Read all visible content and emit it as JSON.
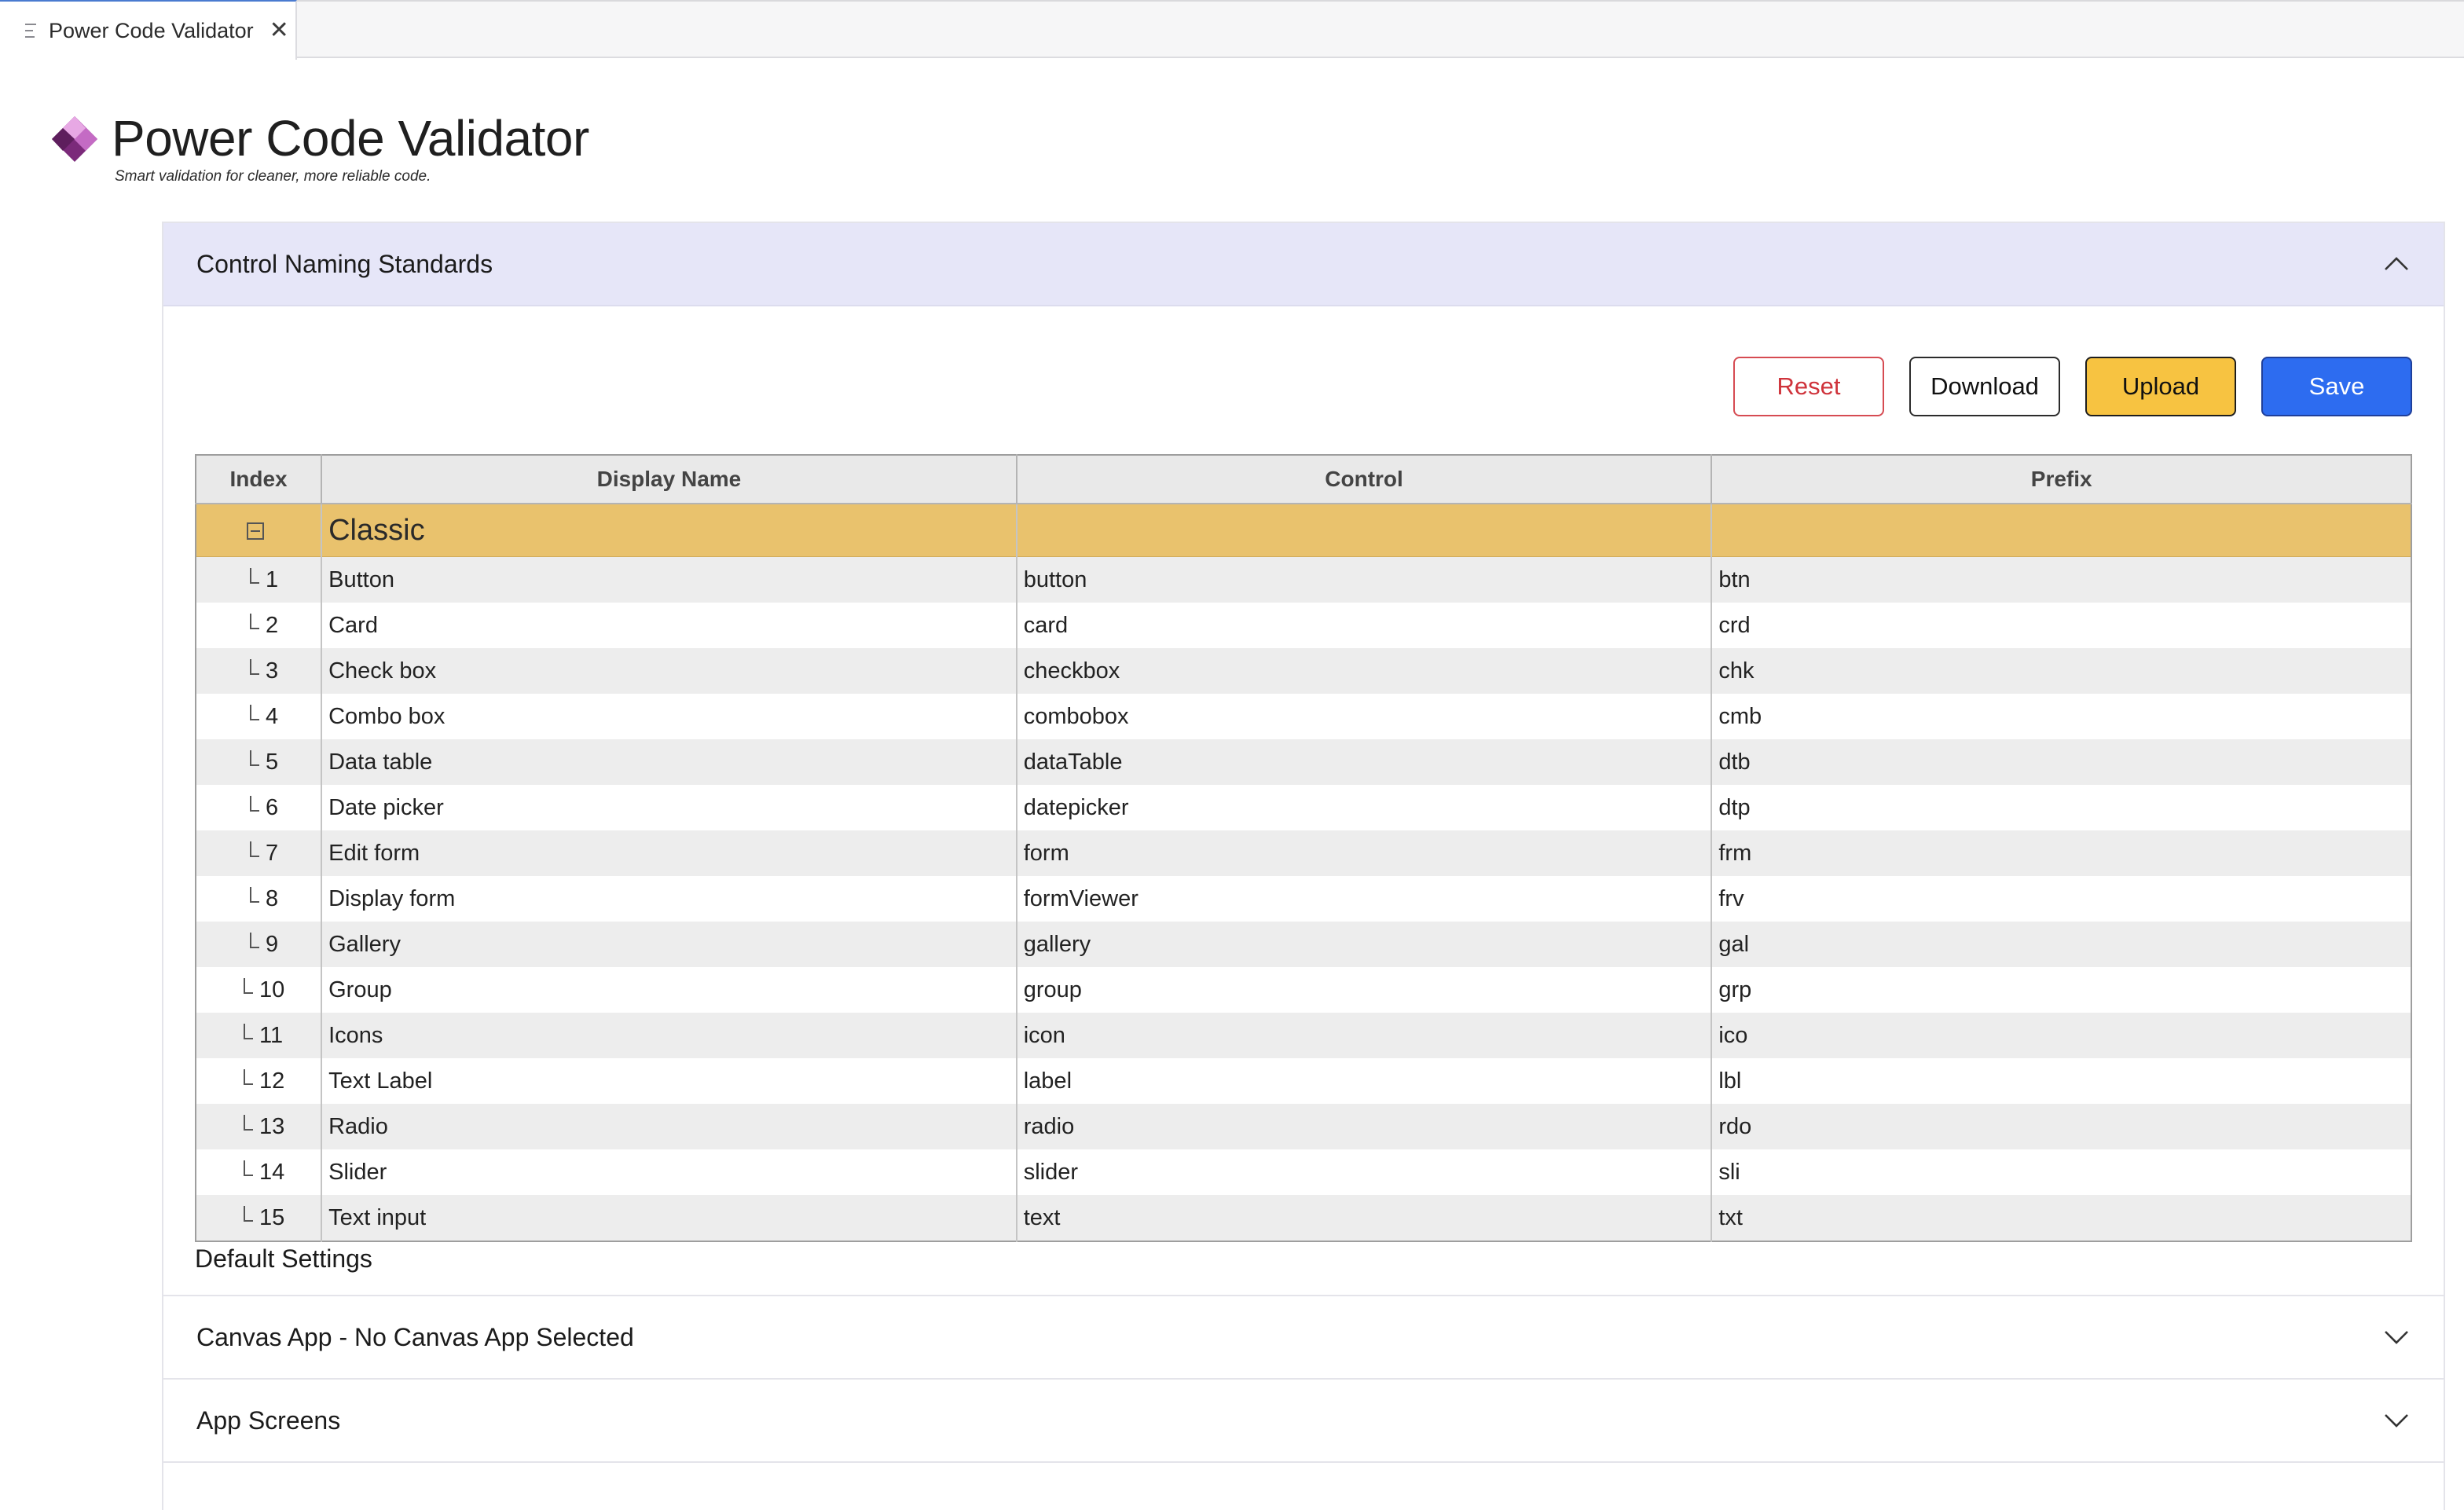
{
  "tab": {
    "label": "Power Code Validator",
    "close_glyph": "✕"
  },
  "header": {
    "title": "Power Code Validator",
    "subtitle": "Smart validation for cleaner, more reliable code.",
    "logo": "power-apps-logo"
  },
  "sections": {
    "naming": {
      "title": "Control Naming Standards",
      "expanded": true
    },
    "canvas": {
      "title": "Canvas App - No Canvas App Selected",
      "expanded": false
    },
    "screens": {
      "title": "App Screens",
      "expanded": false
    }
  },
  "toolbar": {
    "reset": "Reset",
    "download": "Download",
    "upload": "Upload",
    "save": "Save"
  },
  "table": {
    "columns": [
      "Index",
      "Display Name",
      "Control",
      "Prefix"
    ],
    "group": "Classic",
    "rows": [
      {
        "index": "1",
        "display": "Button",
        "control": "button",
        "prefix": "btn"
      },
      {
        "index": "2",
        "display": "Card",
        "control": "card",
        "prefix": "crd"
      },
      {
        "index": "3",
        "display": "Check box",
        "control": "checkbox",
        "prefix": "chk"
      },
      {
        "index": "4",
        "display": "Combo box",
        "control": "combobox",
        "prefix": "cmb"
      },
      {
        "index": "5",
        "display": "Data table",
        "control": "dataTable",
        "prefix": "dtb"
      },
      {
        "index": "6",
        "display": "Date picker",
        "control": "datepicker",
        "prefix": "dtp"
      },
      {
        "index": "7",
        "display": "Edit form",
        "control": "form",
        "prefix": "frm"
      },
      {
        "index": "8",
        "display": "Display form",
        "control": "formViewer",
        "prefix": "frv"
      },
      {
        "index": "9",
        "display": "Gallery",
        "control": "gallery",
        "prefix": "gal"
      },
      {
        "index": "10",
        "display": "Group",
        "control": "group",
        "prefix": "grp"
      },
      {
        "index": "11",
        "display": "Icons",
        "control": "icon",
        "prefix": "ico"
      },
      {
        "index": "12",
        "display": "Text Label",
        "control": "label",
        "prefix": "lbl"
      },
      {
        "index": "13",
        "display": "Radio",
        "control": "radio",
        "prefix": "rdo"
      },
      {
        "index": "14",
        "display": "Slider",
        "control": "slider",
        "prefix": "sli"
      },
      {
        "index": "15",
        "display": "Text input",
        "control": "text",
        "prefix": "txt"
      }
    ]
  },
  "default_settings_label": "Default Settings",
  "colors": {
    "group_row": "#e9c26d",
    "accordion_header": "#e6e6f8",
    "save_button": "#2d6cf0",
    "upload_button": "#f7c341",
    "reset_text": "#cf333b"
  }
}
